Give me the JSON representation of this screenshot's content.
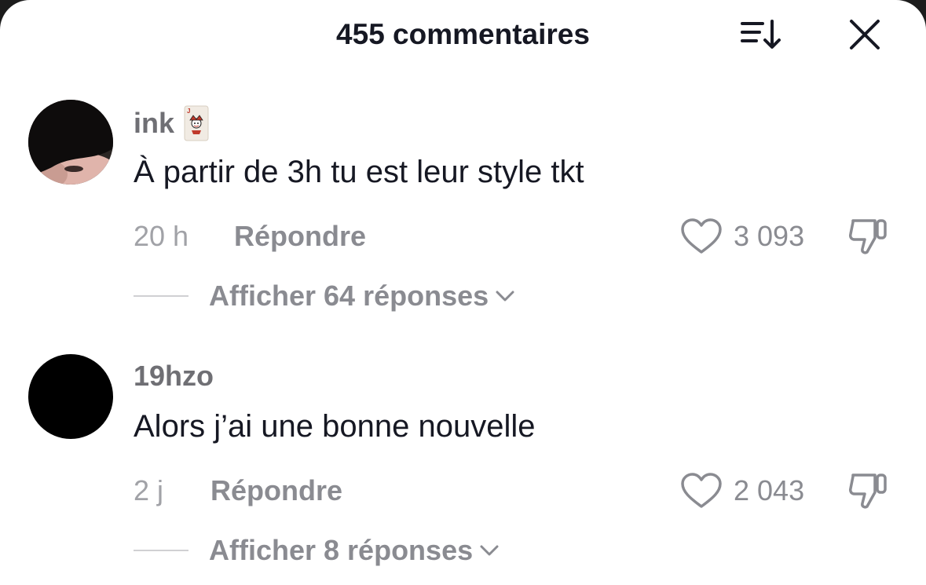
{
  "header": {
    "title": "455 commentaires"
  },
  "icons": {
    "sort": "sort-descending-icon",
    "close": "close-icon",
    "like": "heart-outline-icon",
    "dislike": "thumbs-down-icon",
    "expand": "chevron-down-icon",
    "badge": "joker-card-emoji"
  },
  "colors": {
    "text_primary": "#161823",
    "text_secondary": "#8a8b91",
    "text_muted": "#a1a2a7",
    "background": "#ffffff"
  },
  "comments": [
    {
      "username": "ink",
      "badge_emoji": "🃏",
      "text": "À partir de 3h tu est leur style tkt",
      "time": "20 h",
      "reply_label": "Répondre",
      "likes": "3 093",
      "replies_label": "Afficher 64 réponses"
    },
    {
      "username": "19hzo",
      "text": "Alors j’ai une bonne nouvelle",
      "time": "2 j",
      "reply_label": "Répondre",
      "likes": "2 043",
      "replies_label": "Afficher 8 réponses"
    }
  ]
}
